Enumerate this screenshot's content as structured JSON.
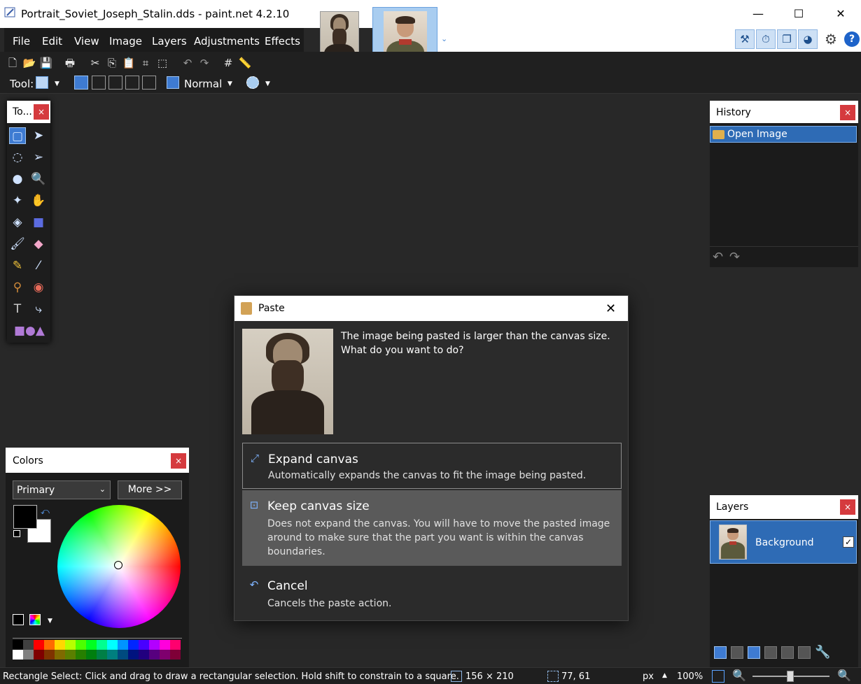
{
  "window": {
    "title": "Portrait_Soviet_Joseph_Stalin.dds - paint.net 4.2.10",
    "minimize": "—",
    "maximize": "☐",
    "close": "✕"
  },
  "menu": {
    "items": [
      "File",
      "Edit",
      "View",
      "Image",
      "Layers",
      "Adjustments",
      "Effects"
    ]
  },
  "toolbar": {
    "tool_label": "Tool:",
    "blend_mode": "Normal"
  },
  "tools_panel": {
    "title": "To...",
    "close": "×"
  },
  "history_panel": {
    "title": "History",
    "close": "×",
    "items": [
      "Open Image"
    ]
  },
  "colors_panel": {
    "title": "Colors",
    "close": "×",
    "mode_select": "Primary",
    "more_button": "More >>",
    "palette_top": [
      "#000000",
      "#404040",
      "#ff0000",
      "#ff6a00",
      "#ffd800",
      "#b6ff00",
      "#4cff00",
      "#00ff21",
      "#00ff90",
      "#00ffff",
      "#0094ff",
      "#0026ff",
      "#4800ff",
      "#b200ff",
      "#ff00dc",
      "#ff006e"
    ],
    "palette_bottom": [
      "#ffffff",
      "#808080",
      "#7f0000",
      "#7f3300",
      "#7f6a00",
      "#5b7f00",
      "#267f00",
      "#007f0e",
      "#007f46",
      "#007f7f",
      "#004a7f",
      "#00137f",
      "#21007f",
      "#57007f",
      "#7f006e",
      "#7f0037"
    ]
  },
  "layers_panel": {
    "title": "Layers",
    "close": "×",
    "layers": [
      {
        "name": "Background",
        "visible": true
      }
    ]
  },
  "paste_dialog": {
    "title": "Paste",
    "message": "The image being pasted is larger than the canvas size. What do you want to do?",
    "options": [
      {
        "title": "Expand canvas",
        "description": "Automatically expands the canvas to fit the image being pasted."
      },
      {
        "title": "Keep canvas size",
        "description": "Does not expand the canvas. You will have to move the pasted image around to make sure that the part you want is within the canvas boundaries."
      },
      {
        "title": "Cancel",
        "description": "Cancels the paste action."
      }
    ]
  },
  "statusbar": {
    "hint": "Rectangle Select: Click and drag to draw a rectangular selection. Hold shift to constrain to a square.",
    "image_size": "156 × 210",
    "cursor_pos": "77, 61",
    "units": "px",
    "zoom": "100%"
  },
  "colors": {
    "accent": "#2e6bb5",
    "close_red": "#d53a3e"
  }
}
